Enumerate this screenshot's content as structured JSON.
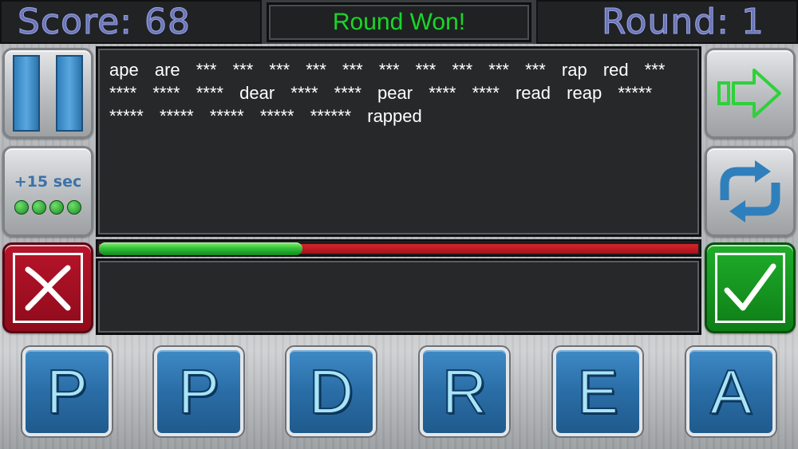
{
  "header": {
    "score_text": "Score: 68",
    "status_text": "Round Won!",
    "round_text": "Round: 1"
  },
  "buttons": {
    "bonus_label": "+15 sec",
    "bonus_dots_remaining": 4
  },
  "words": [
    "ape",
    "are",
    "***",
    "***",
    "***",
    "***",
    "***",
    "***",
    "***",
    "***",
    "***",
    "***",
    "rap",
    "red",
    "***",
    "****",
    "****",
    "****",
    "dear",
    "****",
    "****",
    "pear",
    "****",
    "****",
    "read",
    "reap",
    "*****",
    "*****",
    "*****",
    "*****",
    "*****",
    "******",
    "rapped"
  ],
  "timer": {
    "remaining_fraction": 0.34
  },
  "entry": {
    "current_word": ""
  },
  "tiles": [
    "P",
    "P",
    "D",
    "R",
    "E",
    "A"
  ],
  "colors": {
    "score_text": "#6b76b8",
    "status_text": "#1fd22c",
    "timer_remaining": "#32c23a",
    "timer_elapsed": "#c01a22",
    "tile_fill": "#2a6da6",
    "tile_letter": "#a9e4f6"
  },
  "icons": {
    "pause": "pause-icon",
    "next": "arrow-right-icon",
    "shuffle": "shuffle-icon",
    "clear": "x-icon",
    "submit": "checkmark-icon"
  }
}
